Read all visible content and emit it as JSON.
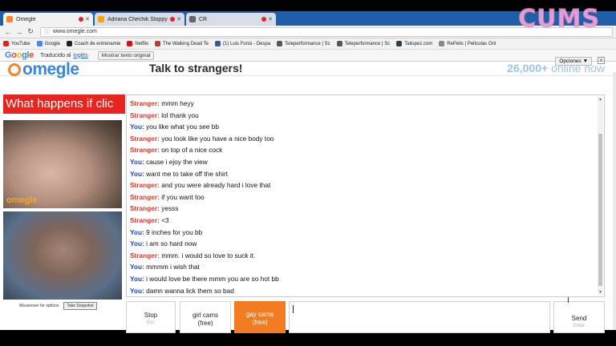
{
  "browser": {
    "tabs": [
      {
        "title": "Omegle",
        "favicon_color": "#f5842c",
        "active": true
      },
      {
        "title": "Adriana Chechik Sloppy",
        "favicon_color": "#f7a600",
        "active": false
      },
      {
        "title": "CR",
        "favicon_color": "#666666",
        "active": false
      }
    ],
    "url": "www.omegle.com",
    "bookmarks": [
      {
        "label": "YouTube",
        "color": "#e62117"
      },
      {
        "label": "Google",
        "color": "#4285f4"
      },
      {
        "label": "Coach de entrenamie",
        "color": "#222222"
      },
      {
        "label": "Netflix",
        "color": "#e50914"
      },
      {
        "label": "The Walking Dead Te",
        "color": "#c0392b"
      },
      {
        "label": "(1) Luis Fonsi - Despa",
        "color": "#3b5998"
      },
      {
        "label": "Teleperformance | Sc",
        "color": "#555555"
      },
      {
        "label": "Teleperformance | Sc",
        "color": "#555555"
      },
      {
        "label": "Tailopez.com",
        "color": "#2c3e50"
      },
      {
        "label": "RePelis | Películas Onl",
        "color": "#888888"
      }
    ]
  },
  "translate_bar": {
    "brand": [
      "G",
      "o",
      "o",
      "g",
      "l",
      "e"
    ],
    "prefix": "Traducido al",
    "language": "inglés",
    "show_original": "Mostrar texto original",
    "options": "Opciones ▼",
    "close": "×"
  },
  "omegle": {
    "logo_text": "omegle",
    "tagline": "Talk to strangers!",
    "online_count": "26,000+",
    "online_label": "online now",
    "banner": "What happens if clic",
    "cam_label": "omegle",
    "mouseover": "Mouseover for options",
    "snapshot": "Take Snapshot"
  },
  "chat": [
    {
      "speaker": "Stranger",
      "role": "s",
      "text": "mmm heyy"
    },
    {
      "speaker": "Stranger",
      "role": "s",
      "text": "lol thank you"
    },
    {
      "speaker": "You",
      "role": "y",
      "text": "you like what you see bb"
    },
    {
      "speaker": "Stranger",
      "role": "s",
      "text": "you look like you have a nice body too"
    },
    {
      "speaker": "Stranger",
      "role": "s",
      "text": "on top of a nice cock"
    },
    {
      "speaker": "You",
      "role": "y",
      "text": "cause i ejoy the view"
    },
    {
      "speaker": "You",
      "role": "y",
      "text": "want me to take off the shirt"
    },
    {
      "speaker": "Stranger",
      "role": "s",
      "text": "and you were already hard i love that"
    },
    {
      "speaker": "Stranger",
      "role": "s",
      "text": "if you want too"
    },
    {
      "speaker": "Stranger",
      "role": "s",
      "text": "yesss"
    },
    {
      "speaker": "Stranger",
      "role": "s",
      "text": "<3"
    },
    {
      "speaker": "You",
      "role": "y",
      "text": "9 inches for you bb"
    },
    {
      "speaker": "You",
      "role": "y",
      "text": "i am so hard now"
    },
    {
      "speaker": "Stranger",
      "role": "s",
      "text": "mmm. i would so love to suck it."
    },
    {
      "speaker": "You",
      "role": "y",
      "text": "mmmm i wish that"
    },
    {
      "speaker": "You",
      "role": "y",
      "text": "i would love be there mmm you are so hot bb"
    },
    {
      "speaker": "You",
      "role": "y",
      "text": "damn wanna lick them so bad"
    }
  ],
  "controls": {
    "stop": "Stop",
    "stop_sub": "Esc",
    "girl_cams": "girl cams",
    "girl_cams_sub": "(free)",
    "gay_cams": "gay cams",
    "gay_cams_sub": "(free)",
    "send": "Send",
    "send_sub": "Enter"
  },
  "watermark": "CUMS"
}
